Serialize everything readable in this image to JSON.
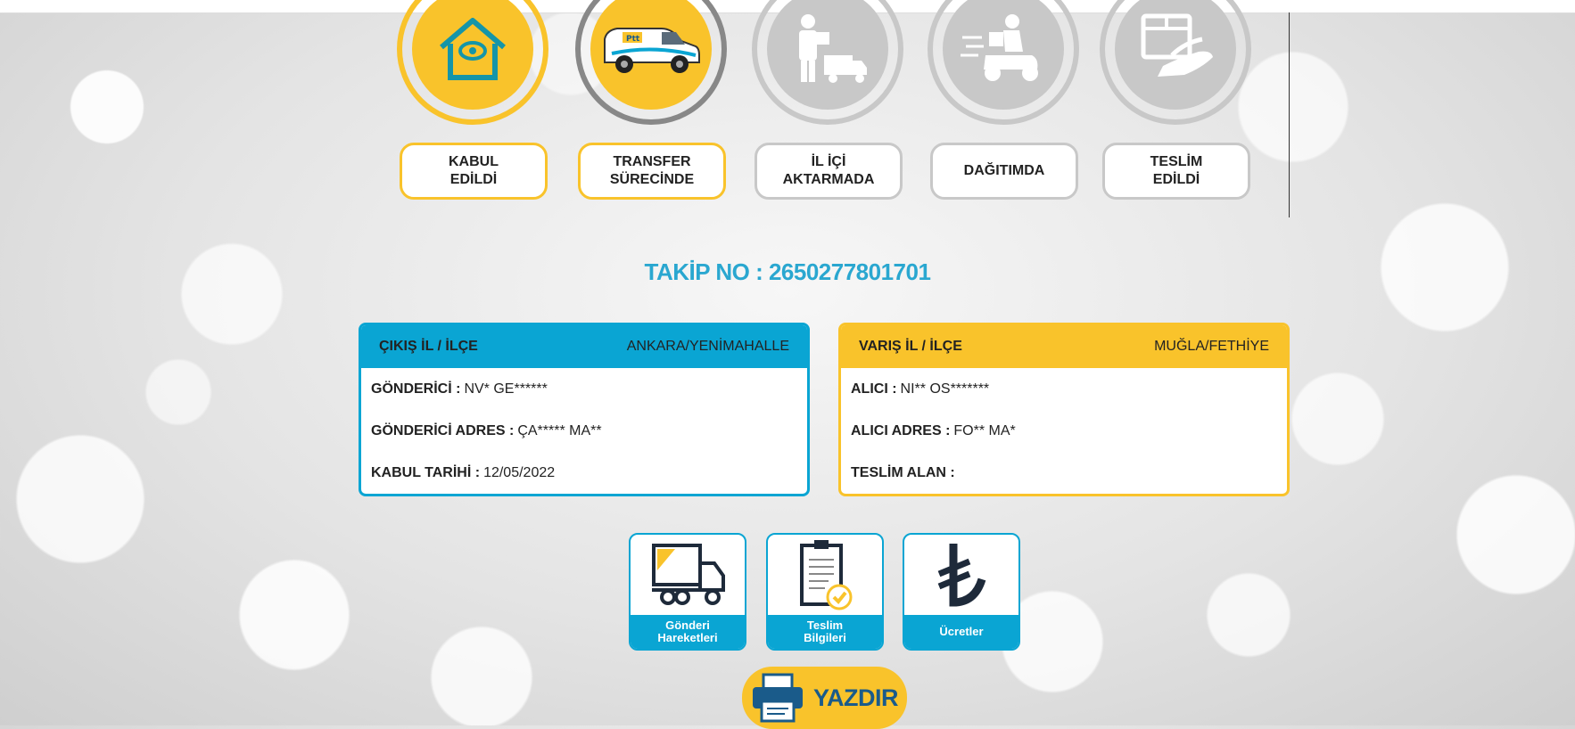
{
  "steps": [
    {
      "label": "KABUL\nEDİLDİ",
      "status": "done",
      "icon": "house-eye-icon"
    },
    {
      "label": "TRANSFER\nSÜRECİNDE",
      "status": "done",
      "icon": "ptt-van-icon"
    },
    {
      "label": "İL İÇİ\nAKTARMADA",
      "status": "pending",
      "icon": "courier-truck-icon"
    },
    {
      "label": "DAĞITIMDA",
      "status": "pending",
      "icon": "scooter-courier-icon"
    },
    {
      "label": "TESLİM\nEDİLDİ",
      "status": "pending",
      "icon": "hand-package-icon"
    }
  ],
  "tracking": {
    "text": "TAKİP NO : 2650277801701"
  },
  "origin": {
    "header_label": "ÇIKIŞ İL / İLÇE",
    "header_value": "ANKARA/YENİMAHALLE",
    "rows": [
      {
        "label": "GÖNDERİCİ :",
        "value": "NV* GE******"
      },
      {
        "label": "GÖNDERİCİ ADRES :",
        "value": "ÇA***** MA**"
      },
      {
        "label": "KABUL TARİHİ :",
        "value": "12/05/2022"
      }
    ]
  },
  "destination": {
    "header_label": "VARIŞ İL / İLÇE",
    "header_value": "MUĞLA/FETHİYE",
    "rows": [
      {
        "label": "ALICI :",
        "value": "NI** OS*******"
      },
      {
        "label": "ALICI ADRES :",
        "value": "FO** MA*"
      },
      {
        "label": "TESLİM ALAN :",
        "value": ""
      }
    ]
  },
  "actions": [
    {
      "label": "Gönderi\nHareketleri",
      "icon": "truck-monitor-icon"
    },
    {
      "label": "Teslim\nBilgileri",
      "icon": "clipboard-check-icon"
    },
    {
      "label": "Ücretler",
      "icon": "lira-icon"
    }
  ],
  "print": {
    "label": "YAZDIR",
    "icon": "printer-icon"
  },
  "colors": {
    "yellow": "#f9c32b",
    "blue": "#0aa5d3",
    "gray": "#c8c8c8",
    "teal_text": "#2aa7d0"
  }
}
